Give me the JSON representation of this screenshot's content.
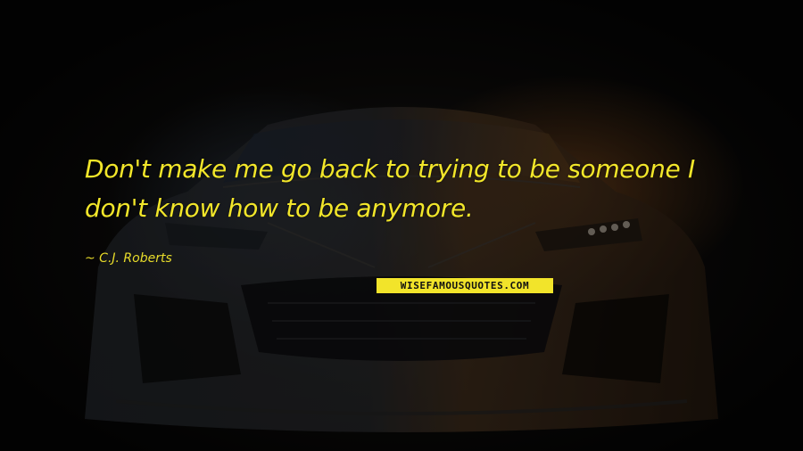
{
  "quote": {
    "line1": "Don't make me go back to trying to be someone I",
    "line2": "don't know how to be anymore."
  },
  "author": "~ C.J. Roberts",
  "watermark": "WISEFAMOUSQUOTES.COM",
  "colors": {
    "quote_text": "#f2e62a",
    "logo_background": "#f2e42a",
    "background": "#050505"
  }
}
